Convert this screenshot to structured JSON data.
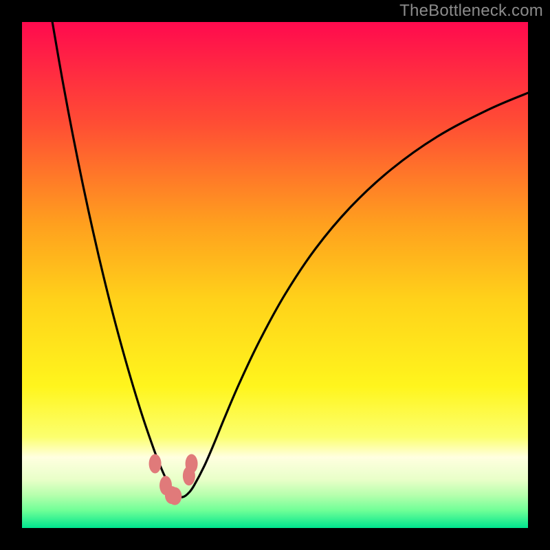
{
  "watermark": {
    "text": "TheBottleneck.com"
  },
  "chart_data": {
    "type": "line",
    "title": "",
    "xlabel": "",
    "ylabel": "",
    "xlim": [
      0,
      1
    ],
    "ylim": [
      0,
      1
    ],
    "background_gradient": [
      {
        "stop": 0.0,
        "color": "#ff0a4e"
      },
      {
        "stop": 0.2,
        "color": "#ff4d34"
      },
      {
        "stop": 0.4,
        "color": "#ffa01e"
      },
      {
        "stop": 0.55,
        "color": "#ffd21a"
      },
      {
        "stop": 0.72,
        "color": "#fff51d"
      },
      {
        "stop": 0.82,
        "color": "#fcff6e"
      },
      {
        "stop": 0.86,
        "color": "#ffffe0"
      },
      {
        "stop": 0.905,
        "color": "#e8ffc8"
      },
      {
        "stop": 0.935,
        "color": "#b6ffad"
      },
      {
        "stop": 0.965,
        "color": "#70ff97"
      },
      {
        "stop": 1.0,
        "color": "#00e58e"
      }
    ],
    "series": [
      {
        "name": "bottleneck-curve",
        "note": "V-shaped curve; y ≈ 1 at bottom, 0 at top; minimum near x≈0.30",
        "x": [
          0.06,
          0.08,
          0.1,
          0.12,
          0.14,
          0.16,
          0.18,
          0.2,
          0.22,
          0.24,
          0.26,
          0.27,
          0.28,
          0.29,
          0.3,
          0.31,
          0.32,
          0.33,
          0.34,
          0.36,
          0.38,
          0.4,
          0.43,
          0.47,
          0.52,
          0.58,
          0.65,
          0.73,
          0.82,
          0.92,
          1.0
        ],
        "y": [
          0.0,
          0.115,
          0.221,
          0.32,
          0.412,
          0.498,
          0.578,
          0.652,
          0.721,
          0.785,
          0.843,
          0.869,
          0.893,
          0.913,
          0.928,
          0.938,
          0.938,
          0.93,
          0.916,
          0.878,
          0.832,
          0.783,
          0.713,
          0.629,
          0.538,
          0.448,
          0.365,
          0.291,
          0.227,
          0.174,
          0.14
        ]
      }
    ],
    "markers": {
      "note": "Rounded salmon markers near curve minimum",
      "color": "#e07a7a",
      "points": [
        {
          "x": 0.263,
          "y": 0.873
        },
        {
          "x": 0.284,
          "y": 0.916
        },
        {
          "x": 0.296,
          "y": 0.935
        },
        {
          "x": 0.302,
          "y": 0.937
        },
        {
          "x": 0.33,
          "y": 0.897
        },
        {
          "x": 0.335,
          "y": 0.873
        }
      ]
    }
  }
}
